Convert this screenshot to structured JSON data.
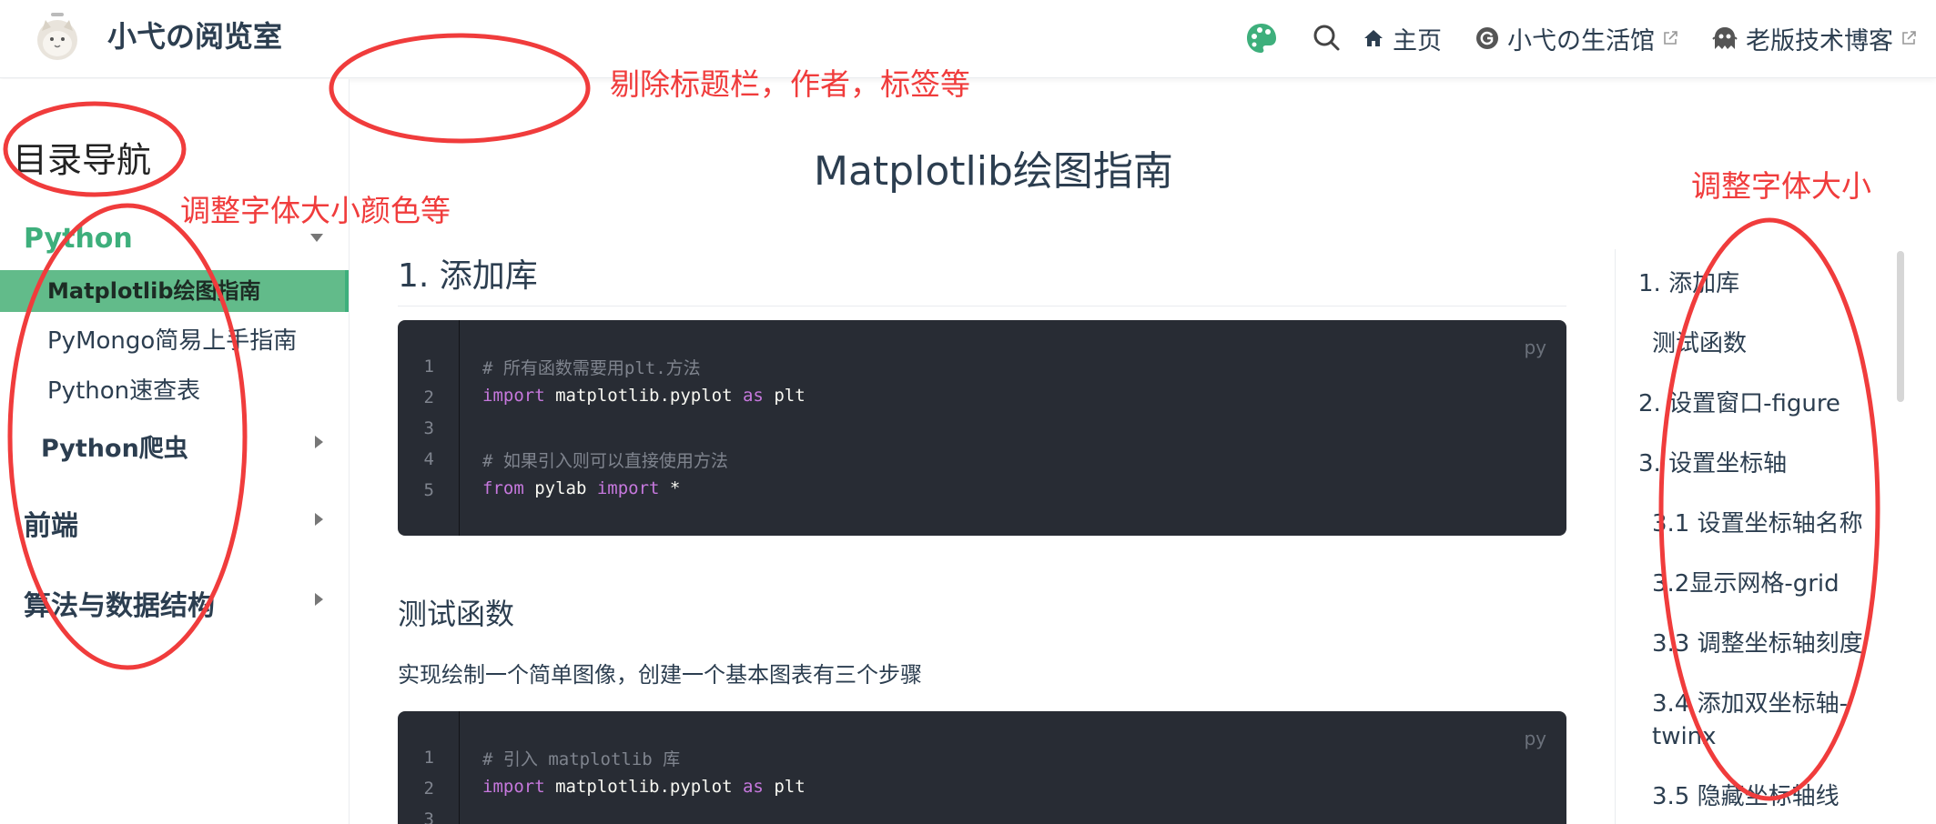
{
  "navbar": {
    "site_name": "小弋の阅览室",
    "links": [
      {
        "label": "主页",
        "icon": "home-icon"
      },
      {
        "label": "小弋の生活馆",
        "icon": "g-circle-icon",
        "external": true
      },
      {
        "label": "老版技术博客",
        "icon": "ghost-icon",
        "external": true
      }
    ],
    "icons": [
      "palette-icon",
      "search-icon"
    ]
  },
  "sidebar": {
    "title": "目录导航",
    "groups": [
      {
        "label": "Python",
        "expanded": true,
        "items": [
          "Matplotlib绘图指南",
          "PyMongo简易上手指南",
          "Python速查表"
        ],
        "subgroups": [
          "Python爬虫"
        ]
      },
      {
        "label": "前端",
        "expanded": false
      },
      {
        "label": "算法与数据结构",
        "expanded": false
      }
    ]
  },
  "main": {
    "page_title": "Matplotlib绘图指南",
    "section1_title": "1. 添加库",
    "code1": {
      "lang": "py",
      "lines": [
        "# 所有函数需要用plt.方法",
        "import matplotlib.pyplot as plt",
        "",
        "# 如果引入则可以直接使用方法",
        "from pylab import *"
      ]
    },
    "section2_title": "测试函数",
    "section2_text": "实现绘制一个简单图像，创建一个基本图表有三个步骤",
    "code2": {
      "lang": "py",
      "lines": [
        "# 引入 matplotlib 库",
        "import matplotlib.pyplot as plt"
      ]
    }
  },
  "toc": {
    "items": [
      "1. 添加库",
      "测试函数",
      "2. 设置窗口-figure",
      "3. 设置坐标轴",
      "3.1 设置坐标轴名称",
      "3.2显示网格-grid",
      "3.3 调整坐标轴刻度",
      "3.4 添加双坐标轴-",
      "twinx",
      "3.5 隐藏坐标轴线"
    ]
  },
  "annotations": {
    "remove_header": "剔除标题栏，作者，标签等",
    "adjust_font_color": "调整字体大小颜色等",
    "adjust_font_size": "调整字体大小",
    "color": "#f03c3c"
  },
  "colors": {
    "accent": "#3eaf7c",
    "active_bg": "#62bb8a",
    "code_bg": "#282c34"
  }
}
